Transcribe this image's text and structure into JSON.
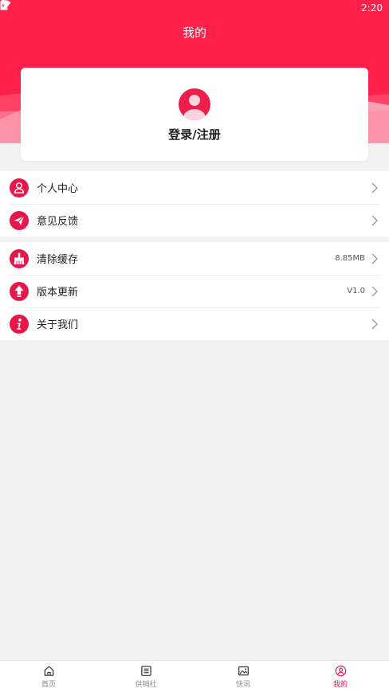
{
  "status_bar": {
    "time": "2:20"
  },
  "header": {
    "title": "我的"
  },
  "login": {
    "label": "登录/注册"
  },
  "menu_group_1": [
    {
      "label": "个人中心",
      "value": "",
      "icon": "person-icon"
    },
    {
      "label": "意见反馈",
      "value": "",
      "icon": "paper-plane-icon"
    }
  ],
  "menu_group_2": [
    {
      "label": "清除缓存",
      "value": "8.85MB",
      "icon": "broom-icon"
    },
    {
      "label": "版本更新",
      "value": "V1.0",
      "icon": "upgrade-icon"
    },
    {
      "label": "关于我们",
      "value": "",
      "icon": "info-icon"
    }
  ],
  "bottom_nav": [
    {
      "label": "首页",
      "icon": "home-icon",
      "active": false
    },
    {
      "label": "供销社",
      "icon": "list-icon",
      "active": false
    },
    {
      "label": "快讯",
      "icon": "image-icon",
      "active": false
    },
    {
      "label": "我的",
      "icon": "profile-icon",
      "active": true
    }
  ],
  "colors": {
    "accent": "#e8174a",
    "background": "#f2f2f2"
  }
}
